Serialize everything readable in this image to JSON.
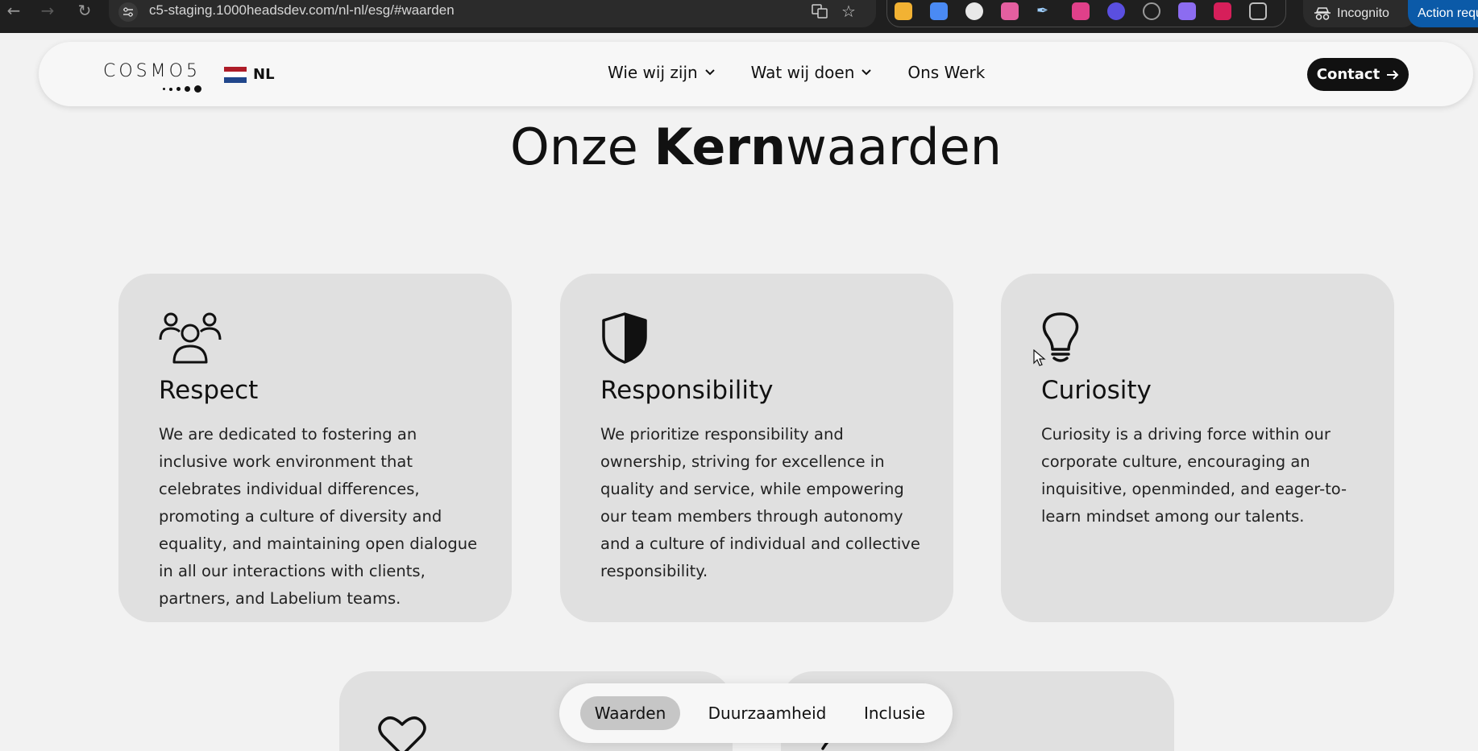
{
  "browser": {
    "url": "c5-staging.1000headsdev.com/nl-nl/esg/#waarden",
    "incognito_label": "Incognito",
    "action_label": "Action requ"
  },
  "site": {
    "logo_text": "COSMO5",
    "language": "NL",
    "nav": [
      {
        "label": "Wie wij zijn",
        "has_dropdown": true
      },
      {
        "label": "Wat wij doen",
        "has_dropdown": true
      },
      {
        "label": "Ons Werk",
        "has_dropdown": false
      }
    ],
    "contact_label": "Contact"
  },
  "section": {
    "heading_prefix": "Onze ",
    "heading_bold": "Kern",
    "heading_suffix": "waarden"
  },
  "cards": [
    {
      "icon": "people-icon",
      "title": "Respect",
      "description": "We are dedicated to fostering an inclusive work environment that celebrates individual differences, promoting a culture of diversity and equality, and maintaining open dialogue in all our interactions with clients, partners, and Labelium teams."
    },
    {
      "icon": "shield-icon",
      "title": "Responsibility",
      "description": "We prioritize responsibility and ownership, striving for excellence in quality and service, while empowering our team members through autonomy and a culture of individual and collective responsibility."
    },
    {
      "icon": "lightbulb-icon",
      "title": "Curiosity",
      "description": "Curiosity is a driving force within our corporate culture, encouraging an inquisitive, openminded, and eager-to-learn mindset among our talents."
    }
  ],
  "lower_cards": [
    {
      "icon": "heart-icon"
    },
    {
      "icon": "plant-icon"
    }
  ],
  "tabs": [
    {
      "label": "Waarden",
      "active": true
    },
    {
      "label": "Duurzaamheid",
      "active": false
    },
    {
      "label": "Inclusie",
      "active": false
    }
  ],
  "colors": {
    "page_bg": "#f2f2f2",
    "card_bg": "#e0e0e0",
    "accent_dark": "#111111",
    "flag_red": "#ae1c28",
    "flag_white": "#ffffff",
    "flag_blue": "#21468b"
  }
}
